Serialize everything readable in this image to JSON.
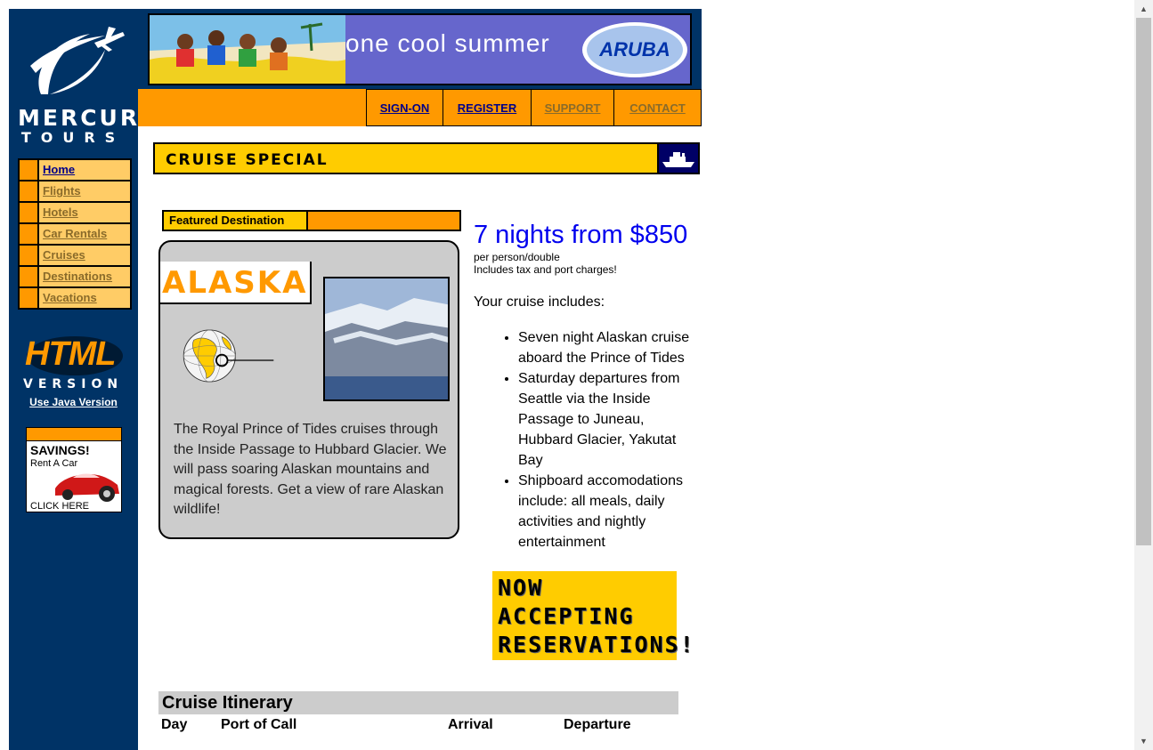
{
  "brand": {
    "line1": "MERCURY",
    "line2": "TOURS"
  },
  "banner": {
    "text": "one cool summer",
    "badge": "ARUBA"
  },
  "topnav": [
    {
      "label": "SIGN-ON"
    },
    {
      "label": "REGISTER"
    },
    {
      "label": "SUPPORT"
    },
    {
      "label": "CONTACT"
    }
  ],
  "sidebar": {
    "menu": [
      {
        "label": "Home"
      },
      {
        "label": "Flights"
      },
      {
        "label": "Hotels"
      },
      {
        "label": "Car Rentals"
      },
      {
        "label": "Cruises"
      },
      {
        "label": "Destinations"
      },
      {
        "label": "Vacations"
      }
    ],
    "version_badge": {
      "line1": "HTML",
      "line2": "VERSION"
    },
    "java_link": "Use Java Version",
    "ad": {
      "title": "SAVINGS!",
      "subtitle": "Rent A Car",
      "cta": "CLICK HERE"
    }
  },
  "section": {
    "title": "CRUISE SPECIAL",
    "icon": "ship-icon"
  },
  "featured": {
    "tab_label": "Featured Destination",
    "name": "ALASKA",
    "description": "The Royal Prince of Tides cruises through the Inside Passage to Hubbard Glacier. We will pass soaring Alaskan mountains and magical forests. Get a view of rare Alaskan wildlife!"
  },
  "offer": {
    "price_line": "7 nights from $850",
    "note1": "per person/double",
    "note2": "Includes tax and port charges!",
    "includes_label": "Your cruise includes:",
    "items": [
      "Seven night Alaskan cruise aboard the Prince of Tides",
      "Saturday departures from Seattle via the Inside Passage to Juneau, Hubbard Glacier, Yakutat Bay",
      "Shipboard accomodations include: all meals, daily activities and nightly entertainment"
    ]
  },
  "reservations": {
    "line1": "NOW",
    "line2": "ACCEPTING",
    "line3": "RESERVATIONS!"
  },
  "itinerary": {
    "title": "Cruise Itinerary",
    "columns": [
      "Day",
      "Port of Call",
      "Arrival",
      "Departure"
    ]
  },
  "colors": {
    "navy": "#003366",
    "orange": "#ff9900",
    "yellow": "#ffcc00",
    "light_orange": "#ffcc66",
    "link_blue": "#0000ee"
  }
}
